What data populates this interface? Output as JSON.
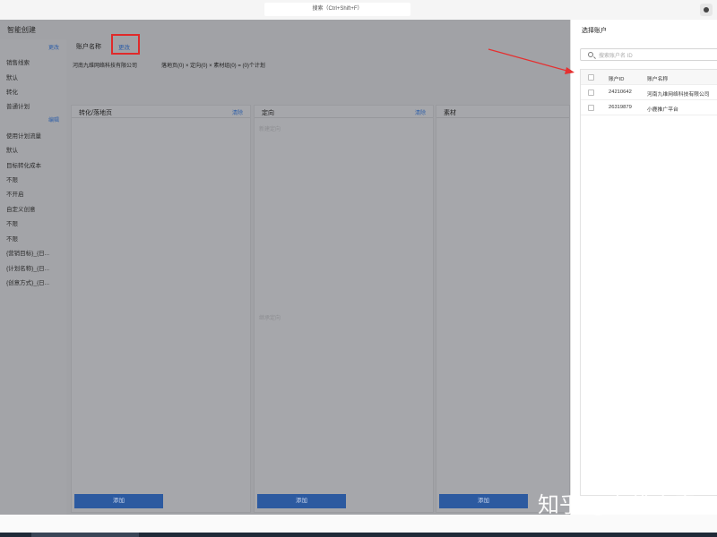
{
  "topbar": {
    "search_label": "搜索（Ctrl+Shift+F）"
  },
  "page": {
    "title": "智能创建",
    "sidebar": {
      "change_label": "更改",
      "edit_label": "编辑",
      "items": [
        "销售线索",
        "默认",
        "转化",
        "普通计划",
        "使用计划流量",
        "默认",
        "目标转化成本",
        "不限",
        "不开启",
        "自定义创意",
        "不限",
        "不限",
        "{营销目标}_{日...",
        "{计划名称}_{日...",
        "{创意方式}_{日..."
      ]
    },
    "account": {
      "label": "账户名称",
      "change_label": "更改",
      "name": "河南九维网络科技有限公司",
      "summary": "落地页(0) × 定向(0) × 素材组(0) = (0)个计划"
    },
    "columns": [
      {
        "title": "转化/落地页",
        "clear": "清除",
        "add": "添加",
        "hints": []
      },
      {
        "title": "定向",
        "clear": "清除",
        "add": "添加",
        "hints": [
          "新建定向",
          "继承定向"
        ]
      },
      {
        "title": "素材",
        "clear": "",
        "add": "添加",
        "hints": []
      }
    ]
  },
  "modal": {
    "title": "选择账户",
    "search_placeholder": "搜索账户名 ID",
    "headers": {
      "id": "账户ID",
      "name": "账户名称"
    },
    "rows": [
      {
        "id": "24210642",
        "name": "河南九维网络科技有限公司"
      },
      {
        "id": "26319879",
        "name": "小鹿推广平台"
      }
    ]
  },
  "watermark": "知乎 @九维小鹿"
}
